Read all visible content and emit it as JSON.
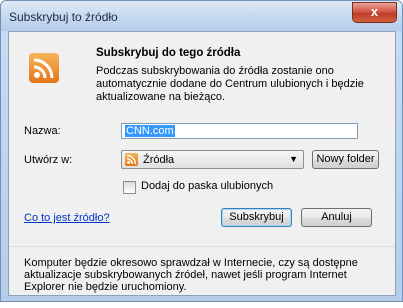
{
  "window": {
    "title": "Subskrybuj to źródło",
    "close_label": "x"
  },
  "dialog": {
    "heading": "Subskrybuj do tego źródła",
    "description": "Podczas subskrybowania do źródła zostanie ono automatycznie dodane do Centrum ulubionych i będzie aktualizowane na bieżąco.",
    "name_label": "Nazwa:",
    "name_value": "CNN.com",
    "create_in_label": "Utwórz w:",
    "folder_selected": "Źródła",
    "new_folder_button": "Nowy folder",
    "add_to_bar_label": "Dodaj do paska ulubionych",
    "add_to_bar_checked": false,
    "what_is_feed_link": "Co to jest źródło?",
    "subscribe_button": "Subskrybuj",
    "cancel_button": "Anuluj",
    "footer_note": "Komputer będzie okresowo sprawdzał w Internecie, czy są dostępne aktualizacje subskrybowanych źródeł, nawet jeśli program Internet Explorer nie będzie uruchomiony."
  },
  "colors": {
    "rss_orange": "#e4761a",
    "link_blue": "#0033cc",
    "close_red": "#c03c2c"
  },
  "icons": {
    "feed": "rss-feed-icon",
    "dropdown": "chevron-down-icon",
    "close": "close-icon"
  }
}
